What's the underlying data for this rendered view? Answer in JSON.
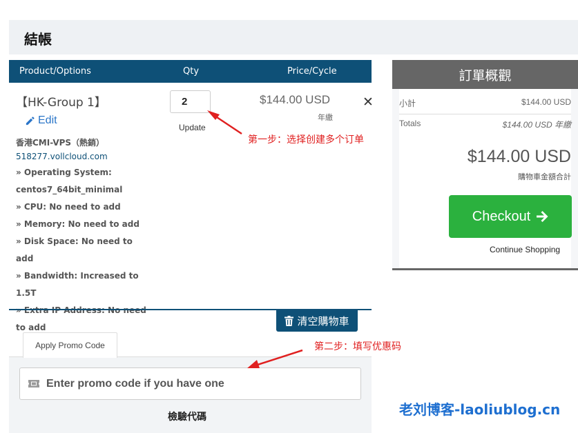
{
  "page": {
    "title": "結帳"
  },
  "table_header": {
    "col_product": "Product/Options",
    "col_qty": "Qty",
    "col_price": "Price/Cycle"
  },
  "item": {
    "title": "【HK-Group 1】",
    "edit_label": "Edit",
    "product_name": "香港CMI-VPS（熱銷）",
    "domain": "518277.vollcloud.com",
    "options": [
      "» Operating System: centos7_64bit_minimal",
      "» CPU: No need to add",
      "» Memory: No need to add",
      "» Disk Space: No need to add",
      "» Bandwidth: Increased to 1.5T",
      "» Extra IP Address: No need to add"
    ],
    "qty": "2",
    "update_label": "Update",
    "price": "$144.00 USD",
    "cycle": "年繳"
  },
  "annotations": {
    "step1": "第一步：选择创建多个订单",
    "step2": "第二步：填写优惠码"
  },
  "empty_cart_label": "清空購物車",
  "promo": {
    "tab_label": "Apply Promo Code",
    "placeholder": "Enter promo code if you have one",
    "validate_label": "檢驗代碼"
  },
  "summary": {
    "title": "訂單概觀",
    "subtotal_label": "小計",
    "subtotal_value": "$144.00 USD",
    "totals_label": "Totals",
    "totals_value": "$144.00 USD 年繳",
    "total_amount": "$144.00 USD",
    "total_caption": "購物車金額合計",
    "checkout_label": "Checkout",
    "continue_label": "Continue Shopping"
  },
  "watermark": "老刘博客-laoliublog.cn",
  "colors": {
    "header_blue": "#0e5077",
    "checkout_green": "#2bb13e",
    "annotation_red": "#e02020"
  }
}
